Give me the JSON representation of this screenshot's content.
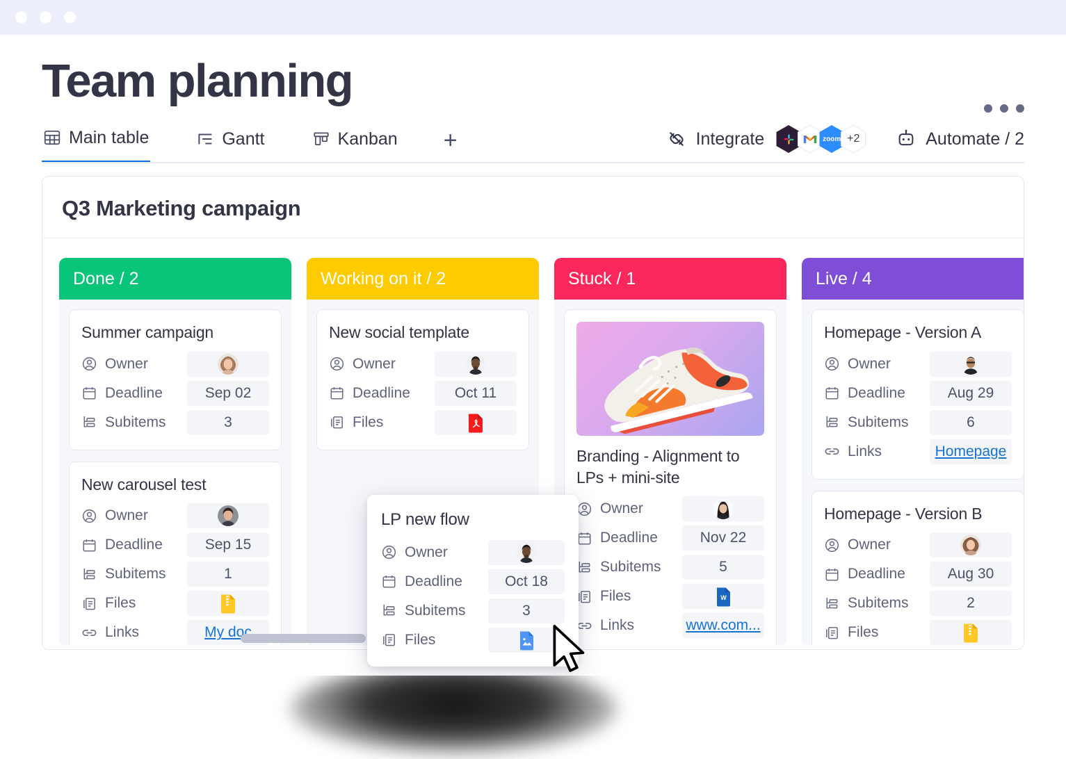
{
  "window": {
    "titlebar_dots": 3
  },
  "header": {
    "page_title": "Team planning",
    "kebab_label": "More options",
    "tabs": [
      {
        "label": "Main table",
        "icon": "table-icon",
        "active": true
      },
      {
        "label": "Gantt",
        "icon": "gantt-icon",
        "active": false
      },
      {
        "label": "Kanban",
        "icon": "kanban-icon",
        "active": false
      }
    ],
    "add_tab_label": "+",
    "integrate": {
      "label": "Integrate",
      "icon": "integration-plug-icon",
      "apps": [
        "slack",
        "gmail",
        "zoom"
      ],
      "overflow_label": "+2"
    },
    "automate": {
      "label": "Automate / 2",
      "icon": "robot-icon"
    }
  },
  "board": {
    "title": "Q3 Marketing campaign",
    "scroll_position": "partial",
    "columns": [
      {
        "name": "Done",
        "count": "2",
        "header_label": "Done / 2",
        "color": "#0ac479",
        "cards": [
          {
            "title": "Summer campaign",
            "fields": [
              {
                "icon": "person-circle-icon",
                "label": "Owner",
                "type": "avatar",
                "value": "avatar-woman-1"
              },
              {
                "icon": "calendar-icon",
                "label": "Deadline",
                "type": "text",
                "value": "Sep 02"
              },
              {
                "icon": "subitems-icon",
                "label": "Subitems",
                "type": "text",
                "value": "3"
              }
            ]
          },
          {
            "title": "New carousel test",
            "fields": [
              {
                "icon": "person-circle-icon",
                "label": "Owner",
                "type": "avatar",
                "value": "avatar-woman-2"
              },
              {
                "icon": "calendar-icon",
                "label": "Deadline",
                "type": "text",
                "value": "Sep 15"
              },
              {
                "icon": "subitems-icon",
                "label": "Subitems",
                "type": "text",
                "value": "1"
              },
              {
                "icon": "files-icon",
                "label": "Files",
                "type": "file",
                "value": "zip-file-icon"
              },
              {
                "icon": "link-icon",
                "label": "Links",
                "type": "link",
                "value": "My doc"
              }
            ]
          }
        ]
      },
      {
        "name": "Working on it",
        "count": "2",
        "header_label": "Working on it / 2",
        "color": "#fdcb00",
        "cards": [
          {
            "title": "New social template",
            "fields": [
              {
                "icon": "person-circle-icon",
                "label": "Owner",
                "type": "avatar",
                "value": "avatar-man-1"
              },
              {
                "icon": "calendar-icon",
                "label": "Deadline",
                "type": "text",
                "value": "Oct 11"
              },
              {
                "icon": "files-icon",
                "label": "Files",
                "type": "file",
                "value": "pdf-file-icon"
              }
            ]
          }
        ]
      },
      {
        "name": "Stuck",
        "count": "1",
        "header_label": "Stuck  / 1",
        "color": "#fb275d",
        "cards": [
          {
            "title": "Branding  - Alignment to LPs + mini-site",
            "image": "sneaker-photo",
            "fields": [
              {
                "icon": "person-circle-icon",
                "label": "Owner",
                "type": "avatar",
                "value": "avatar-woman-3"
              },
              {
                "icon": "calendar-icon",
                "label": "Deadline",
                "type": "text",
                "value": "Nov 22"
              },
              {
                "icon": "subitems-icon",
                "label": "Subitems",
                "type": "text",
                "value": "5"
              },
              {
                "icon": "files-icon",
                "label": "Files",
                "type": "file",
                "value": "word-file-icon"
              },
              {
                "icon": "link-icon",
                "label": "Links",
                "type": "link",
                "value": "www.com..."
              }
            ]
          }
        ]
      },
      {
        "name": "Live",
        "count": "4",
        "header_label": "Live  / 4",
        "color": "#7e4fd6",
        "cards": [
          {
            "title": "Homepage - Version A",
            "fields": [
              {
                "icon": "person-circle-icon",
                "label": "Owner",
                "type": "avatar",
                "value": "avatar-man-2"
              },
              {
                "icon": "calendar-icon",
                "label": "Deadline",
                "type": "text",
                "value": "Aug 29"
              },
              {
                "icon": "subitems-icon",
                "label": "Subitems",
                "type": "text",
                "value": "6"
              },
              {
                "icon": "link-icon",
                "label": "Links",
                "type": "link",
                "value": "Homepage"
              }
            ]
          },
          {
            "title": "Homepage - Version B",
            "fields": [
              {
                "icon": "person-circle-icon",
                "label": "Owner",
                "type": "avatar",
                "value": "avatar-woman-4"
              },
              {
                "icon": "calendar-icon",
                "label": "Deadline",
                "type": "text",
                "value": "Aug 30"
              },
              {
                "icon": "subitems-icon",
                "label": "Subitems",
                "type": "text",
                "value": "2"
              },
              {
                "icon": "files-icon",
                "label": "Files",
                "type": "file",
                "value": "zip-file-icon"
              }
            ]
          }
        ]
      }
    ]
  },
  "floating_card": {
    "title": "LP new flow",
    "fields": [
      {
        "icon": "person-circle-icon",
        "label": "Owner",
        "type": "avatar",
        "value": "avatar-man-1"
      },
      {
        "icon": "calendar-icon",
        "label": "Deadline",
        "type": "text",
        "value": "Oct 18"
      },
      {
        "icon": "subitems-icon",
        "label": "Subitems",
        "type": "text",
        "value": "3"
      },
      {
        "icon": "files-icon",
        "label": "Files",
        "type": "file",
        "value": "image-file-icon"
      }
    ]
  },
  "cursor": {
    "name": "mouse-pointer"
  }
}
